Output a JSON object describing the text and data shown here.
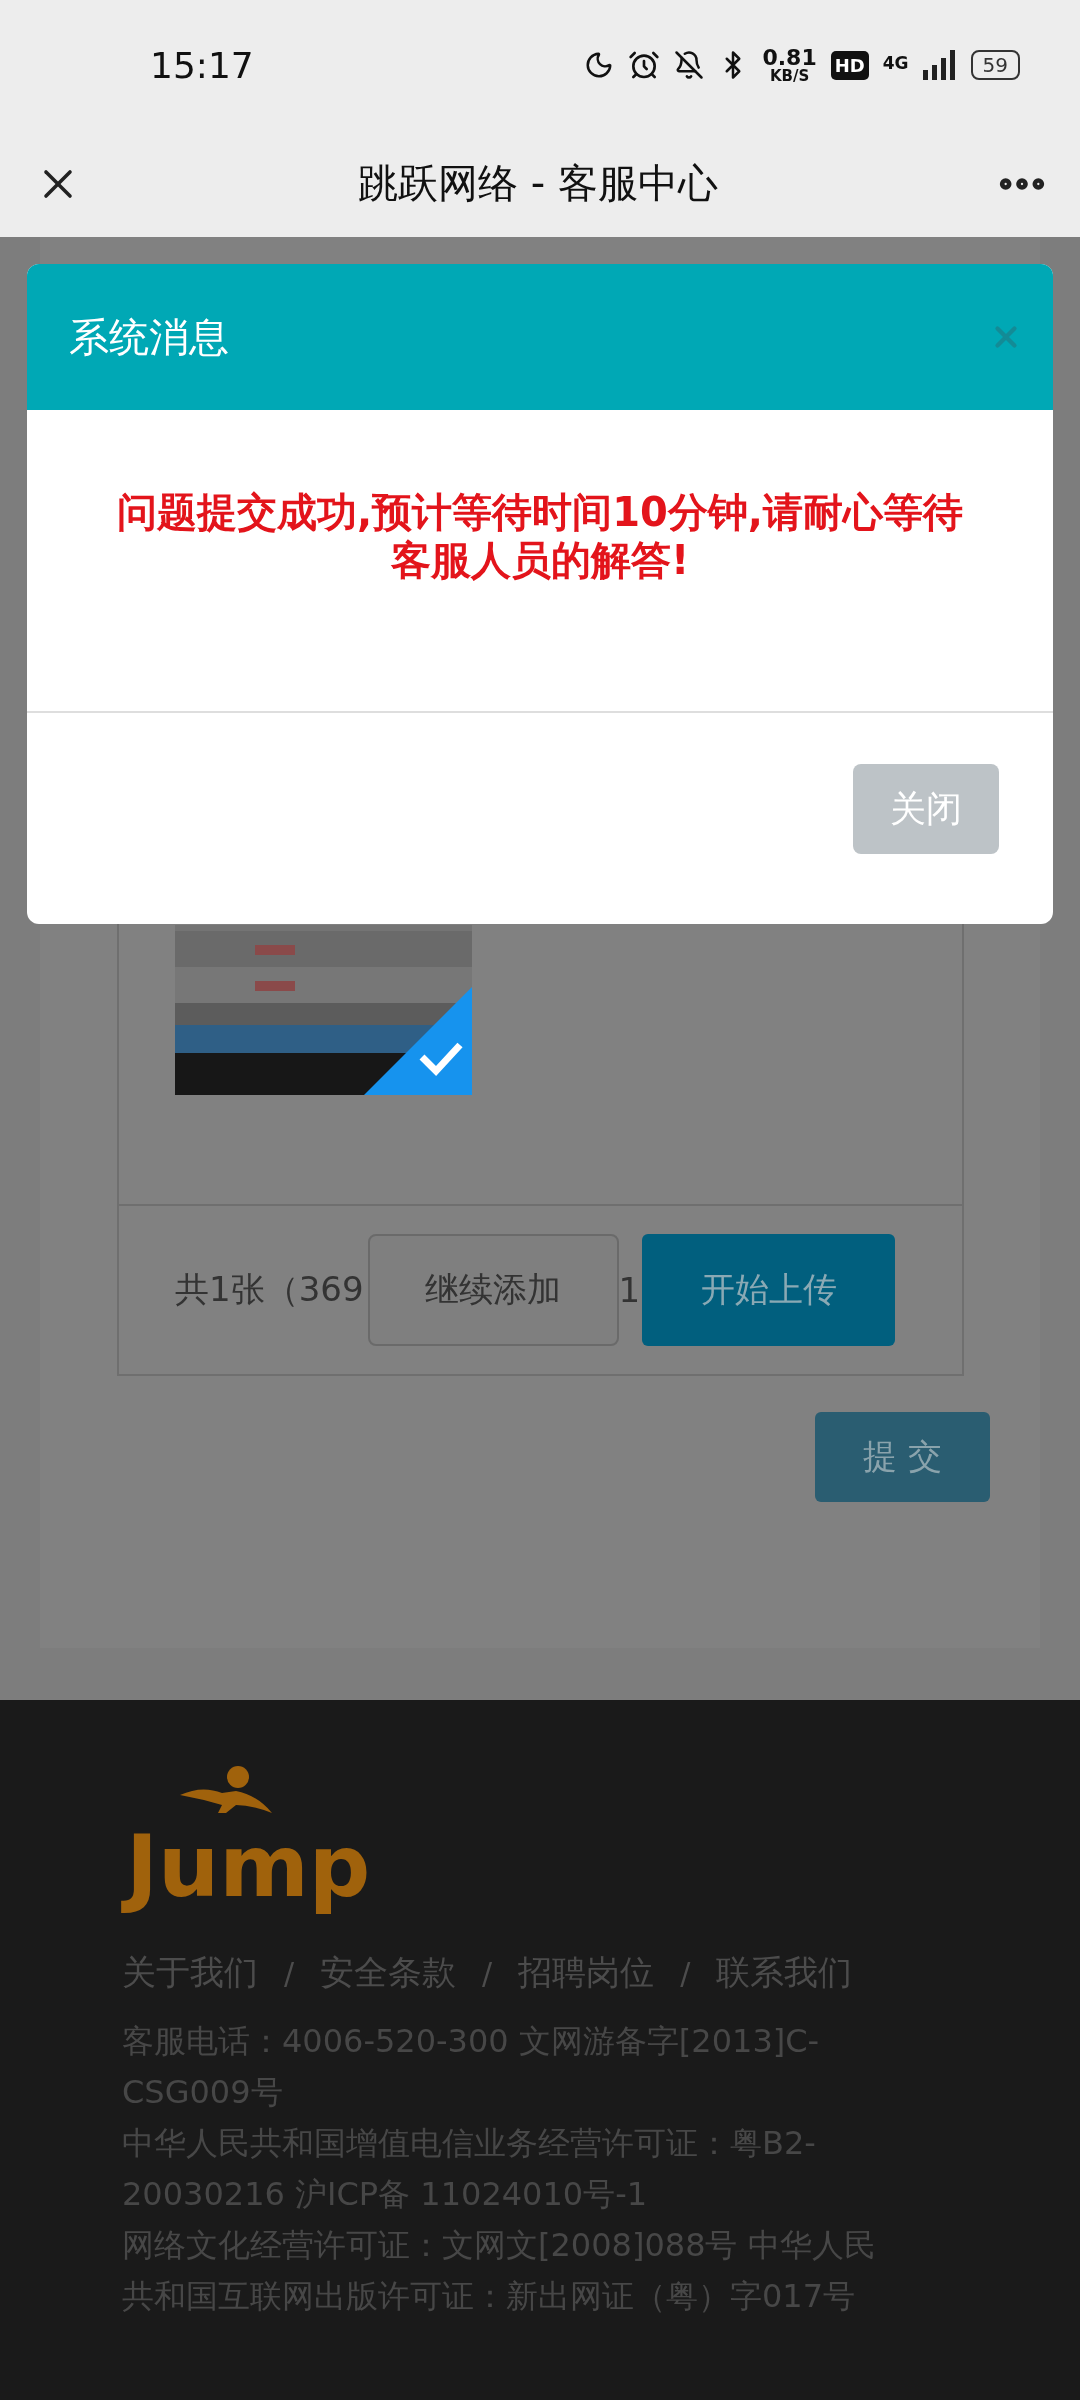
{
  "status_bar": {
    "time": "15:17",
    "net_speed": "0.81",
    "net_unit": "KB/S",
    "hd_badge": "HD",
    "network": "4G",
    "battery": "59"
  },
  "nav": {
    "title": "跳跃网络 - 客服中心"
  },
  "upload": {
    "summary": "共1张（369",
    "summary_tail": "1",
    "add_button": "继续添加",
    "upload_button": "开始上传",
    "thumbnail": {
      "kind": "picture",
      "checked": true
    }
  },
  "submit": "提 交",
  "footer": {
    "logo": "Jump",
    "links": [
      {
        "label": "关于我们",
        "separator": "/"
      },
      {
        "label": "安全条款",
        "separator": "/"
      },
      {
        "label": "招聘岗位",
        "separator": "/"
      },
      {
        "label": "联系我们"
      }
    ],
    "lines": [
      "客服电话：4006-520-300 文网游备字[2013]C-",
      "CSG009号",
      "中华人民共和国增值电信业务经营许可证：粤B2-",
      "20030216 沪ICP备 11024010号-1",
      "网络文化经营许可证：文网文[2008]088号 中华人民",
      "共和国互联网出版许可证：新出网证（粤）字017号"
    ]
  },
  "dialog": {
    "title": "系统消息",
    "message": "问题提交成功,预计等待时间10分钟,请耐心等待客服人员的解答!",
    "close": "关闭"
  }
}
